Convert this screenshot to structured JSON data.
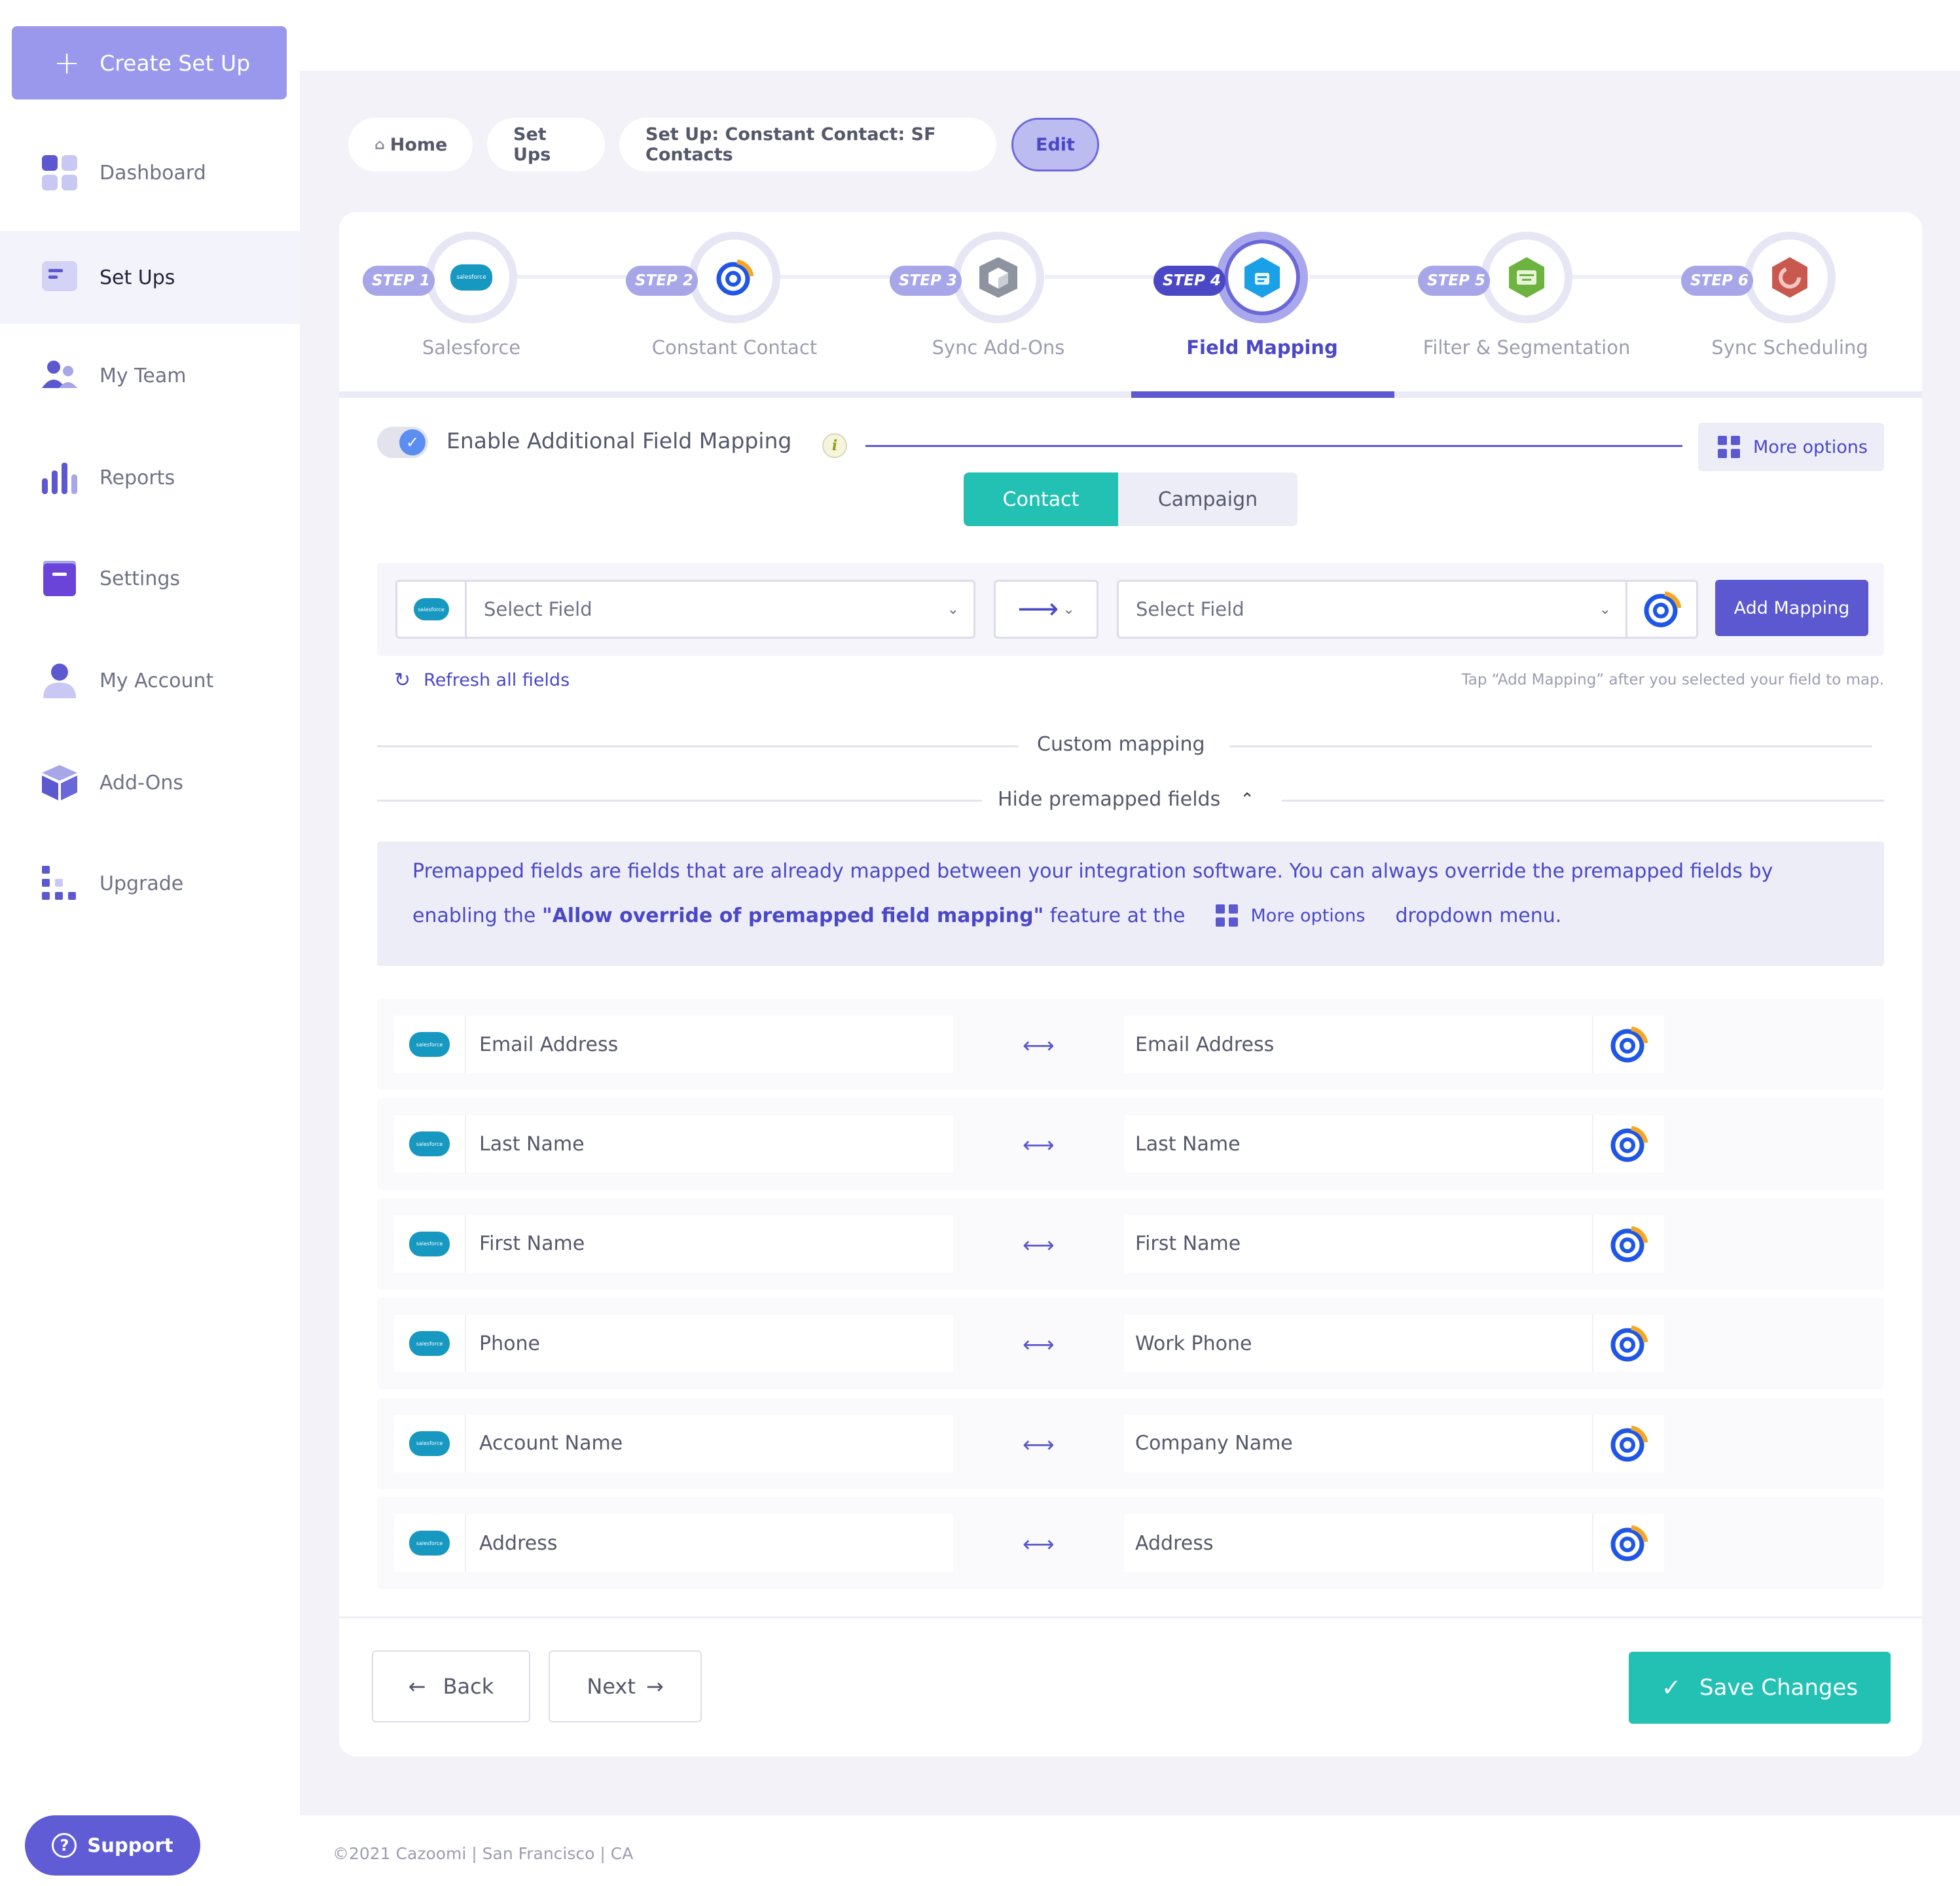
{
  "sidebar": {
    "create_label": "Create Set Up",
    "items": [
      {
        "label": "Dashboard",
        "icon": "dashboard-icon"
      },
      {
        "label": "Set Ups",
        "icon": "setups-icon"
      },
      {
        "label": "My Team",
        "icon": "team-icon"
      },
      {
        "label": "Reports",
        "icon": "reports-icon"
      },
      {
        "label": "Settings",
        "icon": "settings-icon"
      },
      {
        "label": "My Account",
        "icon": "account-icon"
      },
      {
        "label": "Add-Ons",
        "icon": "addons-icon"
      },
      {
        "label": "Upgrade",
        "icon": "upgrade-icon"
      }
    ],
    "support_label": "Support"
  },
  "breadcrumb": {
    "home": "Home",
    "setups": "Set Ups",
    "current": "Set Up: Constant Contact: SF Contacts",
    "edit": "Edit"
  },
  "steps": [
    {
      "tag": "STEP 1",
      "label": "Salesforce"
    },
    {
      "tag": "STEP 2",
      "label": "Constant Contact"
    },
    {
      "tag": "STEP 3",
      "label": "Sync Add-Ons"
    },
    {
      "tag": "STEP 4",
      "label": "Field Mapping"
    },
    {
      "tag": "STEP 5",
      "label": "Filter & Segmentation"
    },
    {
      "tag": "STEP 6",
      "label": "Sync Scheduling"
    }
  ],
  "mapping": {
    "enable_label": "Enable Additional Field Mapping",
    "more_options": "More options",
    "tabs": [
      "Contact",
      "Campaign"
    ],
    "left_select_placeholder": "Select Field",
    "right_select_placeholder": "Select Field",
    "sf_logo_text": "salesforce",
    "add_mapping": "Add Mapping",
    "refresh": "Refresh all fields",
    "tap_hint": "Tap “Add Mapping” after you selected your field to map.",
    "custom_mapping": "Custom mapping",
    "hide_premapped": "Hide premapped fields",
    "info_text_1": "Premapped fields are fields that are already mapped between your integration software. You can always override the premapped fields by",
    "info_text_2a": "enabling the ",
    "info_text_bold": "\"Allow override of premapped field mapping\"",
    "info_text_2b": " feature at the",
    "info_more_options": "More options",
    "info_text_3": "dropdown menu.",
    "rows": [
      {
        "left": "Email Address",
        "right": "Email Address"
      },
      {
        "left": "Last Name",
        "right": "Last Name"
      },
      {
        "left": "First Name",
        "right": "First Name"
      },
      {
        "left": "Phone",
        "right": "Work Phone"
      },
      {
        "left": "Account Name",
        "right": "Company Name"
      },
      {
        "left": "Address",
        "right": "Address"
      }
    ]
  },
  "actions": {
    "back": "Back",
    "next": "Next",
    "save": "Save Changes"
  },
  "footer": "©2021 Cazoomi | San Francisco | CA",
  "colors": {
    "primary": "#5b58d0",
    "teal": "#22c1b3",
    "salesforce": "#1798c1",
    "cc_blue": "#1f56e6",
    "cc_orange": "#f5a623"
  }
}
